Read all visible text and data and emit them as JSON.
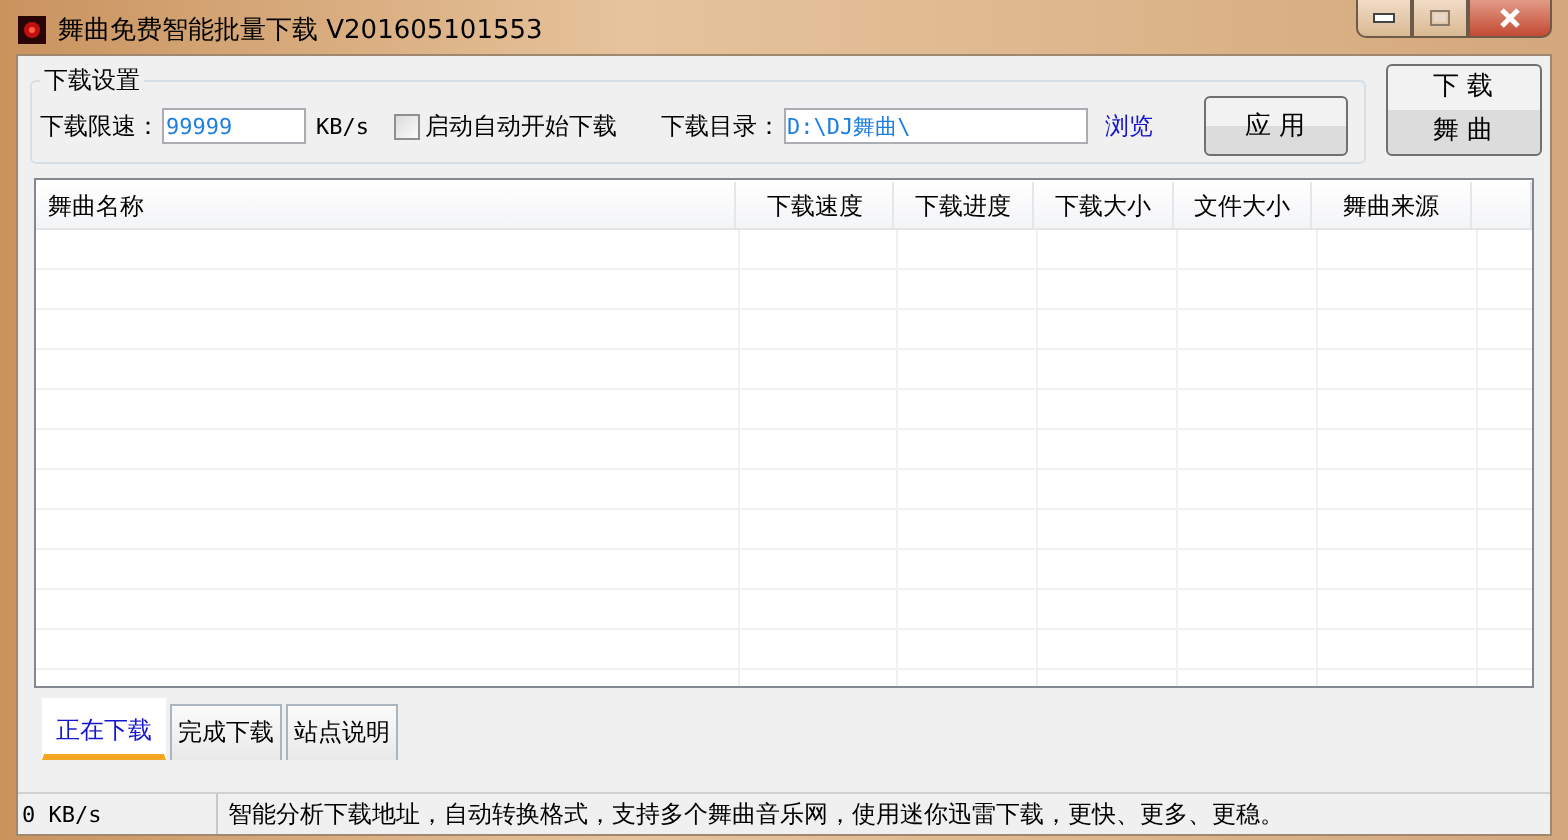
{
  "window": {
    "title": "舞曲免费智能批量下载 V201605101553"
  },
  "settings": {
    "group_label": "下载设置",
    "speed_label": "下载限速：",
    "speed_value": "99999",
    "speed_unit": "KB/s",
    "autostart": {
      "label": "启动自动开始下载",
      "checked": false
    },
    "dir_label": "下载目录：",
    "dir_value": "D:\\DJ舞曲\\",
    "browse": "浏览",
    "apply": "应 用"
  },
  "download_button": [
    "下 载",
    "舞 曲"
  ],
  "table": {
    "columns": [
      "舞曲名称",
      "下载速度",
      "下载进度",
      "下载大小",
      "文件大小",
      "舞曲来源"
    ]
  },
  "tabs": [
    {
      "label": "正在下载",
      "selected": true
    },
    {
      "label": "完成下载",
      "selected": false
    },
    {
      "label": "站点说明",
      "selected": false
    }
  ],
  "status_bar": {
    "speed": "0 KB/s",
    "message": "智能分析下载地址，自动转换格式，支持多个舞曲音乐网，使用迷你迅雷下载，更快、更多、更稳。"
  }
}
